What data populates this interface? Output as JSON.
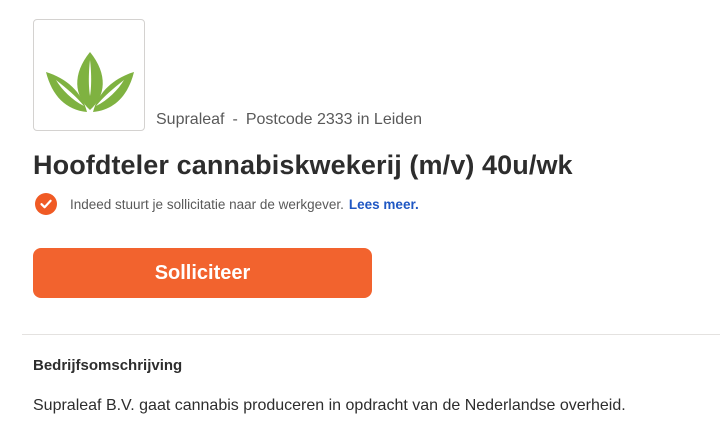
{
  "company": {
    "logo_icon": "leaf-logo-icon",
    "name": "Supraleaf",
    "separator": "-",
    "location": "Postcode 2333 in Leiden"
  },
  "job": {
    "title": "Hoofdteler cannabiskwekerij (m/v) 40u/wk"
  },
  "notice": {
    "icon": "check-circle-icon",
    "text": "Indeed stuurt je sollicitatie naar de werkgever.",
    "link_label": "Lees meer."
  },
  "apply": {
    "label": "Solliciteer"
  },
  "description": {
    "heading": "Bedrijfsomschrijving",
    "body": "Supraleaf B.V. gaat cannabis produceren in opdracht van de Nederlandse overheid."
  },
  "colors": {
    "accent": "#f2632e",
    "link": "#1f57c3",
    "logo_green": "#7fb241"
  }
}
